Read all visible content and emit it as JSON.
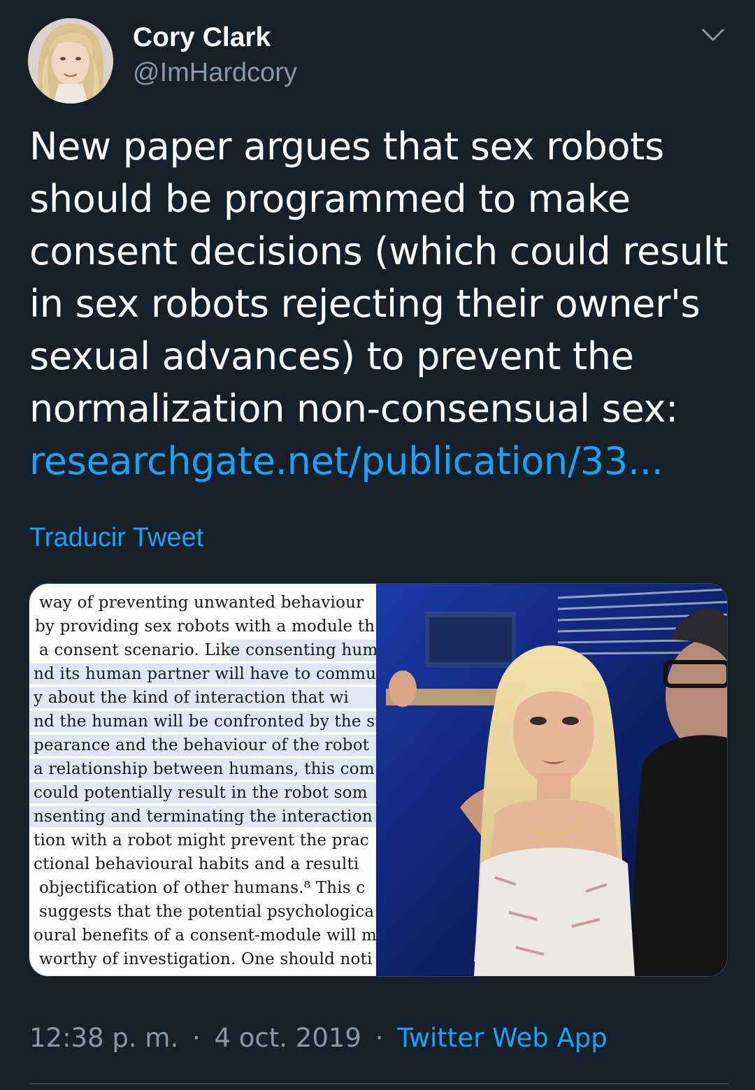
{
  "author": {
    "display_name": "Cory Clark",
    "handle": "@ImHardcory"
  },
  "tweet": {
    "text_lines": [
      "New paper argues that sex robots",
      "should be programmed to make",
      "consent decisions (which could result",
      "in sex robots rejecting their owner's",
      "sexual advances) to prevent the",
      "normalization non-consensual sex:"
    ],
    "link_text": "researchgate.net/publication/33...",
    "translate_label": "Traducir Tweet"
  },
  "media": {
    "paper_excerpt_lines": [
      "way of preventing unwanted behaviour",
      "by providing sex robots with a module th",
      "a consent scenario. Like consenting hum",
      "nd its human partner will have to commu",
      "y about the kind of interaction that wi",
      "nd the human will be confronted by the su",
      "pearance and the behaviour of the robot",
      "a relationship between humans, this com",
      "could potentially result in the robot som",
      "nsenting and terminating the interaction",
      "tion with a robot might prevent the prac",
      "ctional behavioural habits and a resulti",
      "objectification of other humans.⁸ This c",
      "suggests that the potential psychologica",
      "oural benefits of a consent-module will m",
      "worthy of investigation. One should noti"
    ]
  },
  "meta": {
    "time": "12:38 p. m.",
    "separator": "·",
    "date": "4 oct. 2019",
    "source": "Twitter Web App"
  },
  "colors": {
    "background": "#15202b",
    "link": "#1da1f2",
    "secondary_text": "#8899a6",
    "border": "#38444d"
  },
  "icons": {
    "menu": "chevron-down-icon"
  }
}
